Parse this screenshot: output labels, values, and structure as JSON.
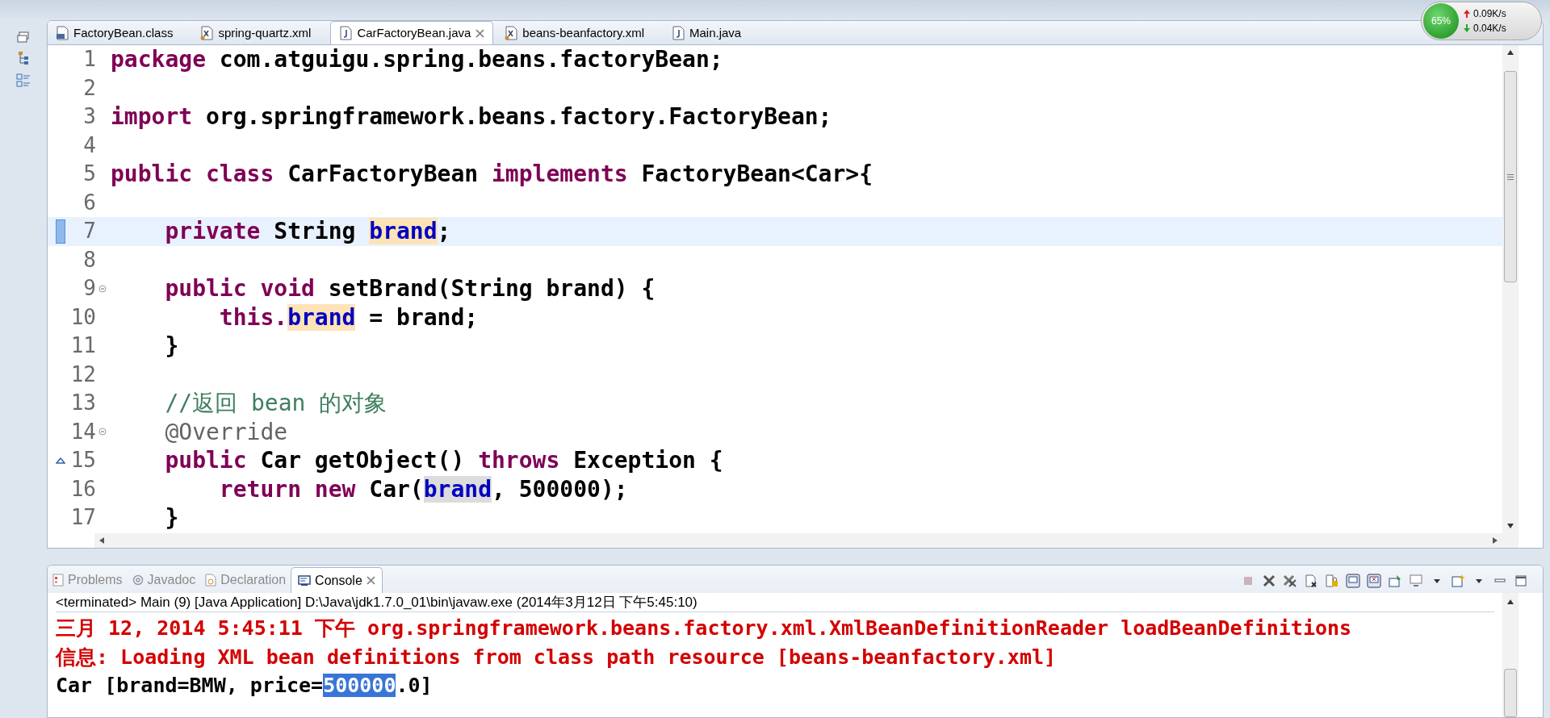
{
  "editor_tabs": [
    {
      "label": "FactoryBean.class",
      "kind": "class",
      "selected": false
    },
    {
      "label": "spring-quartz.xml",
      "kind": "xml",
      "selected": false
    },
    {
      "label": "CarFactoryBean.java",
      "kind": "java",
      "selected": true
    },
    {
      "label": "beans-beanfactory.xml",
      "kind": "xml",
      "selected": false
    },
    {
      "label": "Main.java",
      "kind": "java",
      "selected": false
    }
  ],
  "code_lines": [
    {
      "number": "1",
      "kind": "plain",
      "current": false,
      "fold": false,
      "tokens": [
        {
          "text": "package",
          "kind": "keyword"
        },
        {
          "text": " com.atguigu.spring.beans.factoryBean;",
          "kind": "plain"
        }
      ]
    },
    {
      "number": "2",
      "kind": "plain",
      "current": false,
      "fold": false
    },
    {
      "number": "3",
      "kind": "plain",
      "current": false,
      "fold": false,
      "tokens": [
        {
          "text": "import",
          "kind": "keyword"
        },
        {
          "text": " org.springframework.beans.factory.FactoryBean;",
          "kind": "plain"
        }
      ]
    },
    {
      "number": "4",
      "kind": "plain",
      "current": false,
      "fold": false
    },
    {
      "number": "5",
      "kind": "plain",
      "current": false,
      "fold": false,
      "tokens": [
        {
          "text": "public class",
          "kind": "keyword"
        },
        {
          "text": " CarFactoryBean ",
          "kind": "plain"
        },
        {
          "text": "implements",
          "kind": "keyword"
        },
        {
          "text": " FactoryBean<Car>{",
          "kind": "plain"
        }
      ]
    },
    {
      "number": "6",
      "kind": "plain",
      "current": false,
      "fold": false
    },
    {
      "number": "7",
      "kind": "occurrence",
      "current": true,
      "fold": false,
      "tokens": [
        {
          "text": "    private",
          "kind": "keyword"
        },
        {
          "text": " String ",
          "kind": "plain"
        },
        {
          "text": "brand",
          "kind": "write_occurrence"
        },
        {
          "text": ";",
          "kind": "plain"
        }
      ]
    },
    {
      "number": "8",
      "kind": "plain",
      "current": false,
      "fold": false
    },
    {
      "number": "9",
      "kind": "plain",
      "current": false,
      "fold": true,
      "tokens": [
        {
          "text": "    public void",
          "kind": "keyword"
        },
        {
          "text": " setBrand(String brand) {",
          "kind": "plain"
        }
      ]
    },
    {
      "number": "10",
      "kind": "plain",
      "current": false,
      "fold": false,
      "tokens": [
        {
          "text": "        this.",
          "kind": "keyword"
        },
        {
          "text": "brand",
          "kind": "write_occurrence"
        },
        {
          "text": " = brand;",
          "kind": "plain"
        }
      ]
    },
    {
      "number": "11",
      "kind": "plain",
      "current": false,
      "fold": false,
      "tokens": [
        {
          "text": "    }",
          "kind": "plain"
        }
      ]
    },
    {
      "number": "12",
      "kind": "plain",
      "current": false,
      "fold": false
    },
    {
      "number": "13",
      "kind": "plain",
      "current": false,
      "fold": false,
      "tokens": [
        {
          "text": "    //返回 bean 的对象",
          "kind": "comment"
        }
      ]
    },
    {
      "number": "14",
      "kind": "plain",
      "current": false,
      "fold": true,
      "tokens": [
        {
          "text": "    @Override",
          "kind": "annotation"
        }
      ]
    },
    {
      "number": "15",
      "kind": "override",
      "current": false,
      "fold": false,
      "tokens": [
        {
          "text": "    public",
          "kind": "keyword"
        },
        {
          "text": " Car getObject() ",
          "kind": "plain"
        },
        {
          "text": "throws",
          "kind": "keyword"
        },
        {
          "text": " Exception {",
          "kind": "plain"
        }
      ]
    },
    {
      "number": "16",
      "kind": "plain",
      "current": false,
      "fold": false,
      "tokens": [
        {
          "text": "        return new",
          "kind": "keyword"
        },
        {
          "text": " Car(",
          "kind": "plain"
        },
        {
          "text": "brand",
          "kind": "read_occurrence"
        },
        {
          "text": ", 500000);",
          "kind": "plain"
        }
      ]
    },
    {
      "number": "17",
      "kind": "plain",
      "current": false,
      "fold": false,
      "tokens": [
        {
          "text": "    }",
          "kind": "plain"
        }
      ]
    }
  ],
  "view_tabs": [
    {
      "label": "Problems",
      "kind": "problems",
      "selected": false
    },
    {
      "label": "Javadoc",
      "kind": "javadoc",
      "selected": false
    },
    {
      "label": "Declaration",
      "kind": "declaration",
      "selected": false
    },
    {
      "label": "Console",
      "kind": "console",
      "selected": true
    }
  ],
  "console": {
    "process": "<terminated> Main (9) [Java Application] D:\\Java\\jdk1.7.0_01\\bin\\javaw.exe (2014年3月12日 下午5:45:10)",
    "lines": [
      {
        "kind": "error",
        "segments": [
          {
            "text": "三月 12, 2014 5:45:11 下午 org.springframework.beans.factory.xml.XmlBeanDefinitionReader loadBeanDefinitions",
            "selected": false
          }
        ]
      },
      {
        "kind": "error",
        "segments": [
          {
            "text": "信息: Loading XML bean definitions from class path resource [beans-beanfactory.xml]",
            "selected": false
          }
        ]
      },
      {
        "kind": "output",
        "segments": [
          {
            "text": "Car [brand=BMW, price=",
            "selected": false
          },
          {
            "text": "500000",
            "selected": true
          },
          {
            "text": ".0]",
            "selected": false
          }
        ]
      }
    ]
  },
  "network_widget": {
    "cpu": "65%",
    "upload": "0.09K/s",
    "download": "0.04K/s"
  }
}
